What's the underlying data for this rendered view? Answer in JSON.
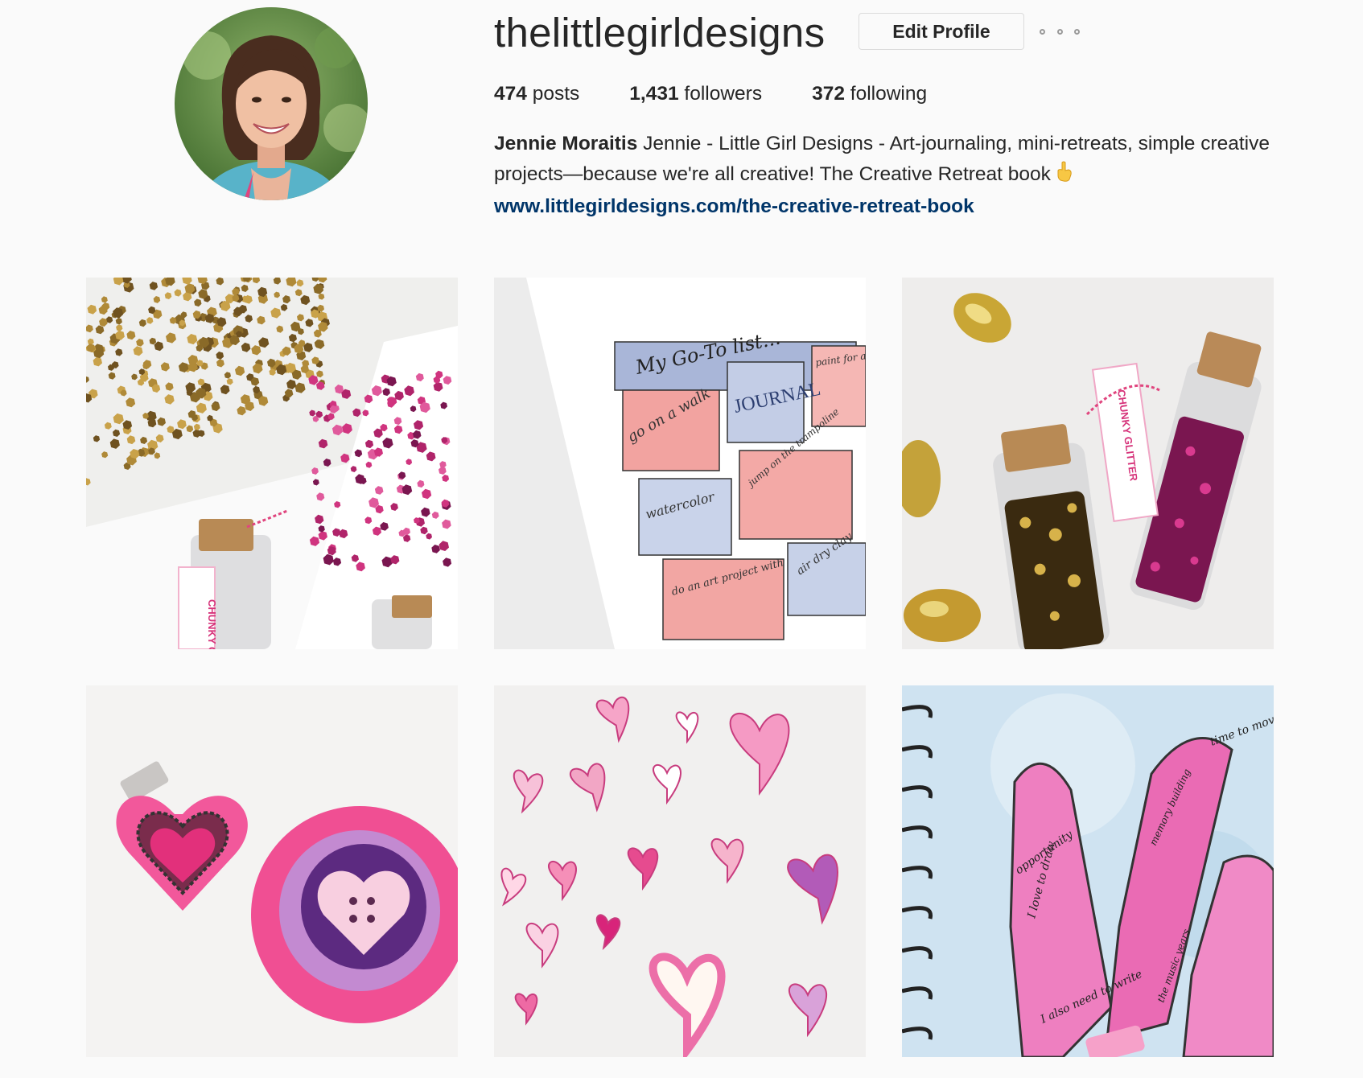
{
  "profile": {
    "username": "thelittlegirldesigns",
    "edit_label": "Edit Profile",
    "more_label": "More options",
    "stats": {
      "posts_count": "474",
      "posts_label": "posts",
      "followers_count": "1,431",
      "followers_label": "followers",
      "following_count": "372",
      "following_label": "following"
    },
    "bio": {
      "full_name": "Jennie Moraitis",
      "text": "Jennie - Little Girl Designs - Art-journaling, mini-retreats, simple creative projects—because we're all creative! The Creative Retreat book",
      "emoji": "pointing-down-emoji",
      "link": "www.littlegirldesigns.com/the-creative-retreat-book"
    }
  },
  "posts": [
    {
      "subject": "gold and pink glitter confetti with chunky glitter jar",
      "labels": [
        "CHUNKY G"
      ]
    },
    {
      "subject": "hand-drawn go-to list",
      "labels": [
        "My Go-To list...",
        "go on a walk",
        "JOURNAL",
        "paint for a few minutes",
        "watercolor",
        "jump on the trampoline",
        "do an art project with",
        "air dry clay"
      ]
    },
    {
      "subject": "glitter jars with gold eggs",
      "labels": [
        "CHUNKY GLITTER"
      ]
    },
    {
      "subject": "felt heart hair clips",
      "labels": []
    },
    {
      "subject": "watercolor paper hearts",
      "labels": []
    },
    {
      "subject": "art journal hand tracing",
      "labels": [
        "time to move on",
        "memory building",
        "opportunity",
        "I love to draw",
        "I also need to write",
        "the music years"
      ]
    }
  ],
  "colors": {
    "text": "#262626",
    "link": "#003569",
    "border": "#dbdbdb",
    "background": "#fafafa"
  }
}
